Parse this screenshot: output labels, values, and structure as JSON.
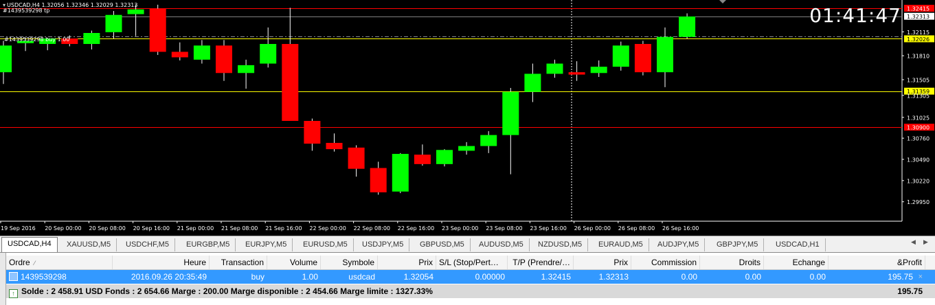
{
  "chart": {
    "header": "USDCAD,H4  1.32056 1.32346 1.32029 1.32313",
    "clock": "01:41:47",
    "tp_label": "#1439539298 tp",
    "buy_label": "#1439539298 buy 1.00",
    "price_range": [
      1.2972,
      1.3245
    ],
    "price_scale": [
      {
        "value": 1.32415,
        "label": "1.32415",
        "bg": "#ff0000",
        "fg": "#ffffff"
      },
      {
        "value": 1.32313,
        "label": "1.32313",
        "bg": "#ffffff",
        "fg": "#000000"
      },
      {
        "value": 1.32115,
        "label": "1.32115",
        "bg": null,
        "fg": "#ffffff"
      },
      {
        "value": 1.32026,
        "label": "1.32026",
        "bg": "#ffff00",
        "fg": "#000000"
      },
      {
        "value": 1.3181,
        "label": "1.31810",
        "bg": null,
        "fg": "#ffffff"
      },
      {
        "value": 1.31505,
        "label": "1.31505",
        "bg": null,
        "fg": "#ffffff"
      },
      {
        "value": 1.31359,
        "label": "1.31359",
        "bg": "#ffff00",
        "fg": "#000000"
      },
      {
        "value": 1.31305,
        "label": "1.31305",
        "bg": null,
        "fg": "#ffffff"
      },
      {
        "value": 1.31025,
        "label": "1.31025",
        "bg": null,
        "fg": "#ffffff"
      },
      {
        "value": 1.309,
        "label": "1.30900",
        "bg": "#ff0000",
        "fg": "#ffffff"
      },
      {
        "value": 1.3076,
        "label": "1.30760",
        "bg": null,
        "fg": "#ffffff"
      },
      {
        "value": 1.3049,
        "label": "1.30490",
        "bg": null,
        "fg": "#ffffff"
      },
      {
        "value": 1.3022,
        "label": "1.30220",
        "bg": null,
        "fg": "#ffffff"
      },
      {
        "value": 1.2995,
        "label": "1.29950",
        "bg": null,
        "fg": "#ffffff"
      }
    ],
    "hlines": [
      {
        "value": 1.32415,
        "color": "#ff0000",
        "style": "solid"
      },
      {
        "value": 1.32313,
        "color": "#808080",
        "style": "solid"
      },
      {
        "value": 1.32056,
        "color": "#909090",
        "style": "dashdot"
      },
      {
        "value": 1.32026,
        "color": "#ffff00",
        "style": "solid"
      },
      {
        "value": 1.31359,
        "color": "#ffff00",
        "style": "solid"
      },
      {
        "value": 1.309,
        "color": "#ff0000",
        "style": "solid"
      }
    ],
    "time_labels": [
      "19 Sep 2016",
      "20 Sep 00:00",
      "20 Sep 08:00",
      "20 Sep 16:00",
      "21 Sep 00:00",
      "21 Sep 08:00",
      "21 Sep 16:00",
      "22 Sep 00:00",
      "22 Sep 08:00",
      "22 Sep 16:00",
      "23 Sep 00:00",
      "23 Sep 08:00",
      "23 Sep 16:00",
      "26 Sep 00:00",
      "26 Sep 08:00",
      "26 Sep 16:00"
    ],
    "bull_color": "#00ff00",
    "bear_color": "#ff0000"
  },
  "chart_data": {
    "type": "candlestick",
    "symbol": "USDCAD",
    "timeframe": "H4",
    "candles": [
      {
        "o": 1.316,
        "h": 1.32,
        "l": 1.3145,
        "c": 1.3194
      },
      {
        "o": 1.3197,
        "h": 1.3204,
        "l": 1.3187,
        "c": 1.32
      },
      {
        "o": 1.3196,
        "h": 1.3204,
        "l": 1.3188,
        "c": 1.3203
      },
      {
        "o": 1.3203,
        "h": 1.3207,
        "l": 1.3193,
        "c": 1.3196
      },
      {
        "o": 1.3196,
        "h": 1.3213,
        "l": 1.3189,
        "c": 1.321
      },
      {
        "o": 1.3211,
        "h": 1.3238,
        "l": 1.3203,
        "c": 1.3233
      },
      {
        "o": 1.3234,
        "h": 1.3246,
        "l": 1.3206,
        "c": 1.324
      },
      {
        "o": 1.3241,
        "h": 1.3246,
        "l": 1.3182,
        "c": 1.3186
      },
      {
        "o": 1.3186,
        "h": 1.3198,
        "l": 1.3175,
        "c": 1.3179
      },
      {
        "o": 1.3176,
        "h": 1.3201,
        "l": 1.3171,
        "c": 1.3194
      },
      {
        "o": 1.3194,
        "h": 1.3201,
        "l": 1.3149,
        "c": 1.3159
      },
      {
        "o": 1.3159,
        "h": 1.3176,
        "l": 1.3139,
        "c": 1.3169
      },
      {
        "o": 1.3171,
        "h": 1.3217,
        "l": 1.3166,
        "c": 1.3196
      },
      {
        "o": 1.3196,
        "h": 1.3242,
        "l": 1.3118,
        "c": 1.3098
      },
      {
        "o": 1.3098,
        "h": 1.3101,
        "l": 1.306,
        "c": 1.3069
      },
      {
        "o": 1.307,
        "h": 1.3082,
        "l": 1.3059,
        "c": 1.3062
      },
      {
        "o": 1.3064,
        "h": 1.3067,
        "l": 1.3027,
        "c": 1.3037
      },
      {
        "o": 1.3038,
        "h": 1.3046,
        "l": 1.3004,
        "c": 1.3007
      },
      {
        "o": 1.3008,
        "h": 1.3057,
        "l": 1.3006,
        "c": 1.3056
      },
      {
        "o": 1.3055,
        "h": 1.3068,
        "l": 1.3041,
        "c": 1.3043
      },
      {
        "o": 1.3043,
        "h": 1.3062,
        "l": 1.304,
        "c": 1.3061
      },
      {
        "o": 1.306,
        "h": 1.3071,
        "l": 1.3055,
        "c": 1.3066
      },
      {
        "o": 1.3066,
        "h": 1.3085,
        "l": 1.3057,
        "c": 1.308
      },
      {
        "o": 1.308,
        "h": 1.314,
        "l": 1.303,
        "c": 1.3135
      },
      {
        "o": 1.3135,
        "h": 1.3171,
        "l": 1.3122,
        "c": 1.3158
      },
      {
        "o": 1.3158,
        "h": 1.3176,
        "l": 1.3153,
        "c": 1.3171
      },
      {
        "o": 1.316,
        "h": 1.3174,
        "l": 1.3149,
        "c": 1.3157
      },
      {
        "o": 1.3159,
        "h": 1.3175,
        "l": 1.3154,
        "c": 1.3167
      },
      {
        "o": 1.3167,
        "h": 1.3199,
        "l": 1.3162,
        "c": 1.3194
      },
      {
        "o": 1.3196,
        "h": 1.32,
        "l": 1.3156,
        "c": 1.316
      },
      {
        "o": 1.316,
        "h": 1.3217,
        "l": 1.3141,
        "c": 1.3205
      },
      {
        "o": 1.3205,
        "h": 1.3235,
        "l": 1.3203,
        "c": 1.3231
      }
    ]
  },
  "tabs": [
    {
      "label": "USDCAD,H4",
      "active": true
    },
    {
      "label": "XAUUSD,M5",
      "active": false
    },
    {
      "label": "USDCHF,M5",
      "active": false
    },
    {
      "label": "EURGBP,M5",
      "active": false
    },
    {
      "label": "EURJPY,M5",
      "active": false
    },
    {
      "label": "EURUSD,M5",
      "active": false
    },
    {
      "label": "USDJPY,M5",
      "active": false
    },
    {
      "label": "GBPUSD,M5",
      "active": false
    },
    {
      "label": "AUDUSD,M5",
      "active": false
    },
    {
      "label": "NZDUSD,M5",
      "active": false
    },
    {
      "label": "EURAUD,M5",
      "active": false
    },
    {
      "label": "AUDJPY,M5",
      "active": false
    },
    {
      "label": "GBPJPY,M5",
      "active": false
    },
    {
      "label": "USDCAD,H1",
      "active": false
    }
  ],
  "terminal": {
    "columns": [
      "Ordre",
      "Heure",
      "Transaction",
      "Volume",
      "Symbole",
      "Prix",
      "S/L (Stop/Pert…",
      "T/P (Prendre/…",
      "Prix",
      "Commission",
      "Droits",
      "Echange",
      "&Profit"
    ],
    "row": [
      "1439539298",
      "2016.09.26 20:35:49",
      "buy",
      "1.00",
      "usdcad",
      "1.32054",
      "0.00000",
      "1.32415",
      "1.32313",
      "0.00",
      "0.00",
      "0.00",
      "195.75"
    ],
    "summary": "Solde : 2 458.91 USD  Fonds : 2 654.66  Marge : 200.00  Marge disponible : 2 454.66  Marge limite : 1327.33%",
    "summary_profit": "195.75"
  }
}
